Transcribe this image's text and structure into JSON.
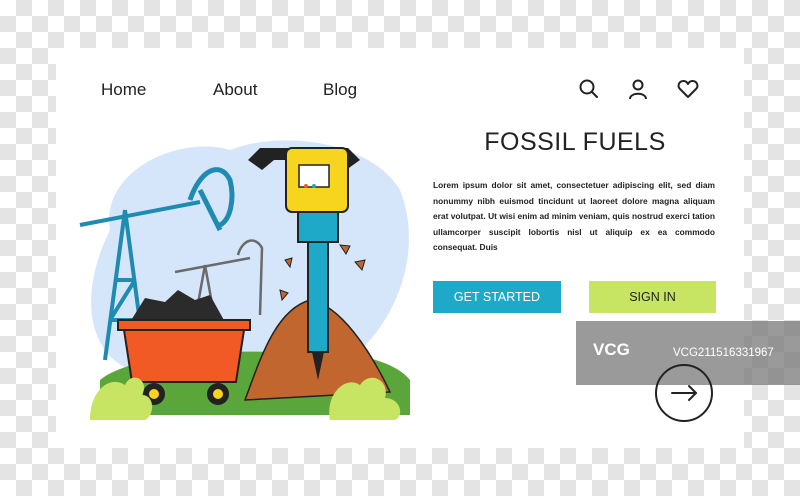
{
  "nav": {
    "items": [
      {
        "label": "Home"
      },
      {
        "label": "About"
      },
      {
        "label": "Blog"
      }
    ],
    "icons": [
      "search-icon",
      "user-icon",
      "heart-icon"
    ]
  },
  "hero": {
    "title": "FOSSIL FUELS",
    "body": "Lorem ipsum dolor sit amet, consectetuer adipiscing elit, sed diam nonummy nibh euismod tincidunt ut laoreet dolore magna aliquam erat volutpat. Ut wisi enim ad minim veniam, quis nostrud exerci tation ullamcorper suscipit lobortis nisl ut aliquip ex ea commodo consequat. Duis",
    "primary_button": "GET STARTED",
    "secondary_button": "SIGN IN",
    "next_icon": "arrow-right-icon"
  },
  "watermark": {
    "logo": "VCG",
    "id": "VCG211516331967"
  },
  "colors": {
    "accent_blue": "#1fa9c9",
    "accent_green": "#c7e463",
    "drill_yellow": "#f7d51e",
    "cart_orange": "#f15a24",
    "soil_brown": "#c1662f",
    "blob_blue": "#d6e6fa"
  }
}
